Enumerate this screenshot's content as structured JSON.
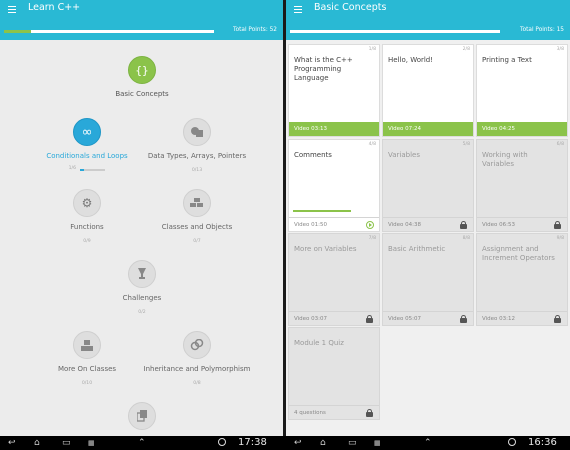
{
  "left": {
    "title": "Learn C++",
    "points": "Total Points: 52",
    "progress_fraction": 0.13,
    "nodes": [
      {
        "label": "Basic Concepts",
        "count": "",
        "icon": "curly-braces-icon",
        "state": "done"
      },
      {
        "label": "Conditionals and Loops",
        "count": "1/6",
        "icon": "infinity-icon",
        "state": "active"
      },
      {
        "label": "Data Types, Arrays, Pointers",
        "count": "0/13",
        "icon": "shapes-icon",
        "state": "locked"
      },
      {
        "label": "Functions",
        "count": "0/9",
        "icon": "gears-icon",
        "state": "locked"
      },
      {
        "label": "Classes and Objects",
        "count": "0/7",
        "icon": "blocks-icon",
        "state": "locked"
      },
      {
        "label": "Challenges",
        "count": "0/2",
        "icon": "trophy-icon",
        "state": "locked"
      },
      {
        "label": "More On Classes",
        "count": "0/10",
        "icon": "pyramid-blocks-icon",
        "state": "locked"
      },
      {
        "label": "Inheritance and Polymorphism",
        "count": "0/8",
        "icon": "link-icon",
        "state": "locked"
      },
      {
        "label": "",
        "count": "",
        "icon": "copy-icon",
        "state": "locked"
      }
    ],
    "active_node_progress_fraction": 0.17
  },
  "right": {
    "title": "Basic Concepts",
    "points": "Total Points: 15",
    "progress_fraction": 0.95,
    "cards": [
      {
        "title": "What is the C++ Programming Language",
        "count": "1/8",
        "footer": "Video 03:13",
        "state": "done"
      },
      {
        "title": "Hello, World!",
        "count": "2/8",
        "footer": "Video 07:24",
        "state": "done"
      },
      {
        "title": "Printing a Text",
        "count": "3/8",
        "footer": "Video 04:25",
        "state": "done"
      },
      {
        "title": "Comments",
        "count": "4/8",
        "footer": "Video 01:50",
        "state": "current"
      },
      {
        "title": "Variables",
        "count": "5/8",
        "footer": "Video 04:38",
        "state": "locked"
      },
      {
        "title": "Working with Variables",
        "count": "6/8",
        "footer": "Video 06:53",
        "state": "locked"
      },
      {
        "title": "More on Variables",
        "count": "7/8",
        "footer": "Video 03:07",
        "state": "locked"
      },
      {
        "title": "Basic Arithmetic",
        "count": "8/8",
        "footer": "Video 05:07",
        "state": "locked"
      },
      {
        "title": "Assignment and Increment Operators",
        "count": "9/8",
        "footer": "Video 03:12",
        "state": "locked"
      },
      {
        "title": "Module 1 Quiz",
        "count": "",
        "footer": "4 questions",
        "state": "locked"
      }
    ]
  },
  "navbar": {
    "left_time": "17:38",
    "right_time": "16:36"
  },
  "colors": {
    "accent": "#29b9d4",
    "progress": "#8bc34a",
    "active": "#29a8d9"
  }
}
